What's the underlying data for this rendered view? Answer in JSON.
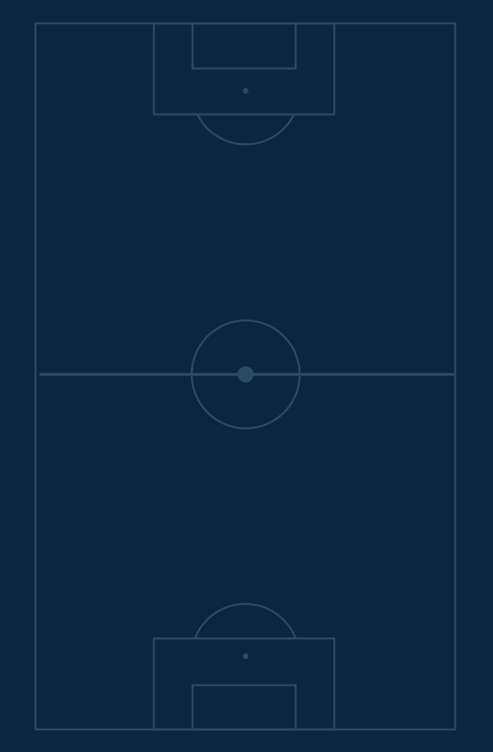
{
  "pitch": {
    "background_color": "#0a2640",
    "line_color": "#2d4a65",
    "spot_color": "#2d4a65"
  }
}
